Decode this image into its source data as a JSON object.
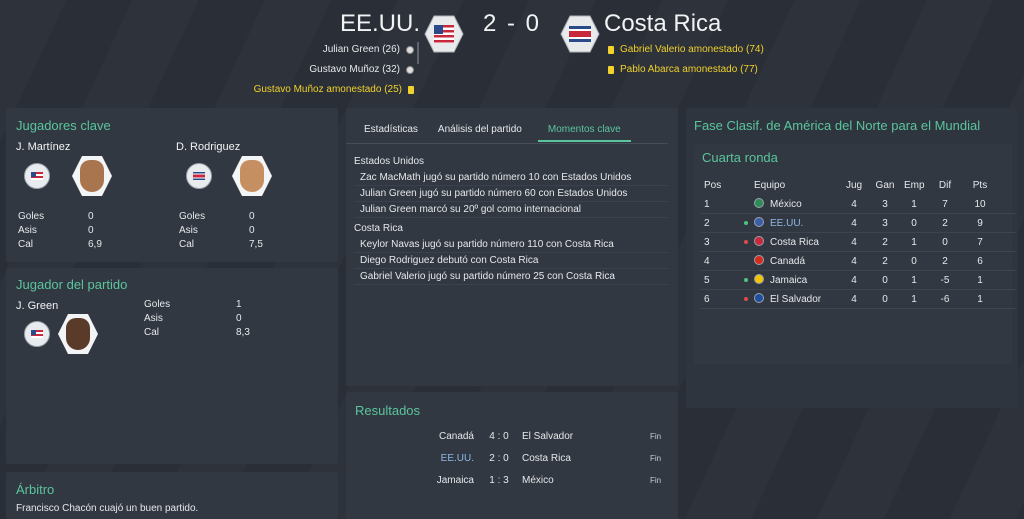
{
  "match": {
    "home_team": "EE.UU.",
    "away_team": "Costa Rica",
    "score": "2 - 0",
    "home_events": [
      {
        "text": "Julian Green (26)",
        "type": "goal"
      },
      {
        "text": "Gustavo Muñoz (32)",
        "type": "goal"
      },
      {
        "text": "Gustavo Muñoz amonestado (25)",
        "type": "card"
      }
    ],
    "away_events": [
      {
        "text": "Gabriel Valerio amonestado (74)",
        "type": "card"
      },
      {
        "text": "Pablo Abarca amonestado (77)",
        "type": "card"
      }
    ]
  },
  "key_players": {
    "title": "Jugadores clave",
    "home": {
      "name": "J. Martínez",
      "stats": [
        {
          "k": "Goles",
          "v": "0"
        },
        {
          "k": "Asis",
          "v": "0"
        },
        {
          "k": "Cal",
          "v": "6,9"
        }
      ]
    },
    "away": {
      "name": "D. Rodriguez",
      "stats": [
        {
          "k": "Goles",
          "v": "0"
        },
        {
          "k": "Asis",
          "v": "0"
        },
        {
          "k": "Cal",
          "v": "7,5"
        }
      ]
    }
  },
  "player_of_match": {
    "title": "Jugador del partido",
    "name": "J. Green",
    "stats": [
      {
        "k": "Goles",
        "v": "1"
      },
      {
        "k": "Asis",
        "v": "0"
      },
      {
        "k": "Cal",
        "v": "8,3"
      }
    ]
  },
  "referee": {
    "title": "Árbitro",
    "text": "Francisco Chacón cuajó un buen partido."
  },
  "tabs": [
    {
      "label": "Estadísticas",
      "active": false
    },
    {
      "label": "Análisis del partido",
      "active": false
    },
    {
      "label": "Momentos clave",
      "active": true
    }
  ],
  "moments": [
    {
      "group": "Estados Unidos",
      "items": [
        "Zac MacMath jugó su partido número 10 con Estados Unidos",
        "Julian Green jugó su partido número 60 con Estados Unidos",
        "Julian Green marcó su 20º gol como internacional"
      ]
    },
    {
      "group": "Costa Rica",
      "items": [
        "Keylor Navas jugó su partido número 110 con Costa Rica",
        "Diego Rodriguez debutó con Costa Rica",
        "Gabriel Valerio jugó su partido número 25 con Costa Rica"
      ]
    }
  ],
  "results": {
    "title": "Resultados",
    "rows": [
      {
        "home": "Canadá",
        "score": "4 : 0",
        "away": "El Salvador",
        "status": "Fin",
        "highlight": false
      },
      {
        "home": "EE.UU.",
        "score": "2 : 0",
        "away": "Costa Rica",
        "status": "Fin",
        "highlight": true
      },
      {
        "home": "Jamaica",
        "score": "1 : 3",
        "away": "México",
        "status": "Fin",
        "highlight": false
      }
    ]
  },
  "competition": {
    "title": "Fase Clasif. de América del Norte para el Mundial",
    "round": "Cuarta ronda",
    "columns": {
      "pos": "Pos",
      "team": "Equipo",
      "jug": "Jug",
      "gan": "Gan",
      "emp": "Emp",
      "dif": "Dif",
      "pts": "Pts"
    },
    "rows": [
      {
        "pos": "1",
        "team": "México",
        "jug": "4",
        "gan": "3",
        "emp": "1",
        "dif": "7",
        "pts": "10",
        "move": "",
        "flag_color": "#2e8b57",
        "highlight": false
      },
      {
        "pos": "2",
        "team": "EE.UU.",
        "jug": "4",
        "gan": "3",
        "emp": "0",
        "dif": "2",
        "pts": "9",
        "move": "up",
        "flag_color": "#3a5fa8",
        "highlight": true
      },
      {
        "pos": "3",
        "team": "Costa Rica",
        "jug": "4",
        "gan": "2",
        "emp": "1",
        "dif": "0",
        "pts": "7",
        "move": "down",
        "flag_color": "#c8283c",
        "highlight": false
      },
      {
        "pos": "4",
        "team": "Canadá",
        "jug": "4",
        "gan": "2",
        "emp": "0",
        "dif": "2",
        "pts": "6",
        "move": "",
        "flag_color": "#d52b1e",
        "highlight": false
      },
      {
        "pos": "5",
        "team": "Jamaica",
        "jug": "4",
        "gan": "0",
        "emp": "1",
        "dif": "-5",
        "pts": "1",
        "move": "up",
        "flag_color": "#f2c500",
        "highlight": false
      },
      {
        "pos": "6",
        "team": "El Salvador",
        "jug": "4",
        "gan": "0",
        "emp": "1",
        "dif": "-6",
        "pts": "1",
        "move": "down",
        "flag_color": "#1f4fa0",
        "highlight": false
      }
    ]
  }
}
